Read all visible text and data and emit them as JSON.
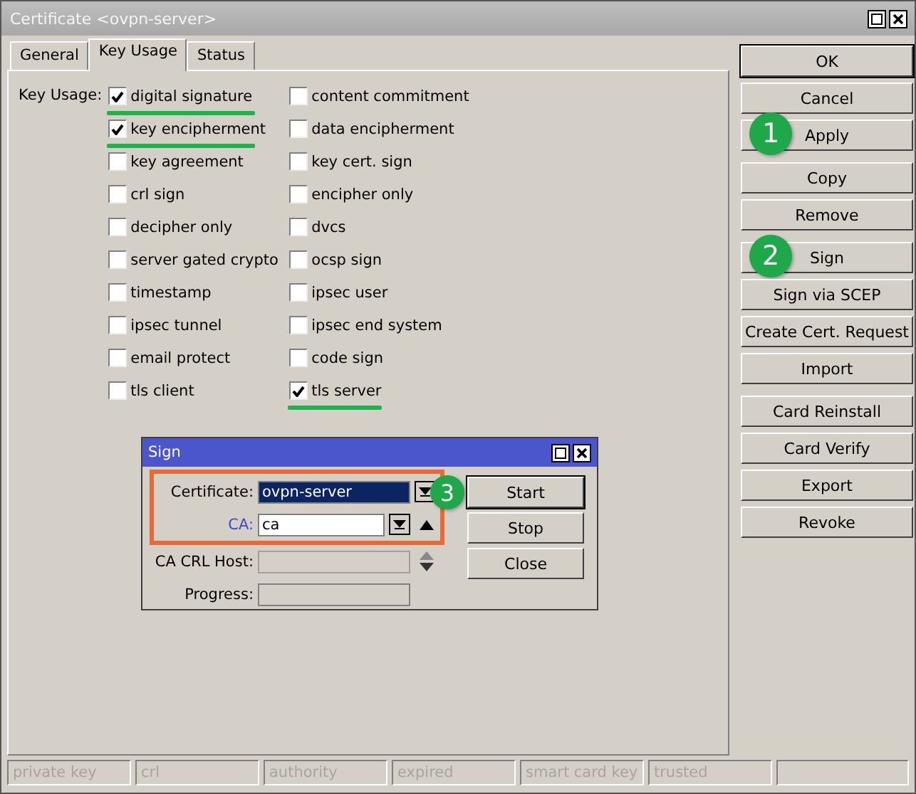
{
  "window": {
    "title": "Certificate <ovpn-server>"
  },
  "tabs": [
    {
      "label": "General",
      "selected": false
    },
    {
      "label": "Key Usage",
      "selected": true
    },
    {
      "label": "Status",
      "selected": false
    }
  ],
  "key_usage": {
    "label": "Key Usage:",
    "columns": [
      [
        {
          "label": "digital signature",
          "checked": true,
          "underlined": true
        },
        {
          "label": "key encipherment",
          "checked": true,
          "underlined": true
        },
        {
          "label": "key agreement",
          "checked": false,
          "underlined": false
        },
        {
          "label": "crl sign",
          "checked": false,
          "underlined": false
        },
        {
          "label": "decipher only",
          "checked": false,
          "underlined": false
        },
        {
          "label": "server gated crypto",
          "checked": false,
          "underlined": false
        },
        {
          "label": "timestamp",
          "checked": false,
          "underlined": false
        },
        {
          "label": "ipsec tunnel",
          "checked": false,
          "underlined": false
        },
        {
          "label": "email protect",
          "checked": false,
          "underlined": false
        },
        {
          "label": "tls client",
          "checked": false,
          "underlined": false
        }
      ],
      [
        {
          "label": "content commitment",
          "checked": false,
          "underlined": false
        },
        {
          "label": "data encipherment",
          "checked": false,
          "underlined": false
        },
        {
          "label": "key cert. sign",
          "checked": false,
          "underlined": false
        },
        {
          "label": "encipher only",
          "checked": false,
          "underlined": false
        },
        {
          "label": "dvcs",
          "checked": false,
          "underlined": false
        },
        {
          "label": "ocsp sign",
          "checked": false,
          "underlined": false
        },
        {
          "label": "ipsec user",
          "checked": false,
          "underlined": false
        },
        {
          "label": "ipsec end system",
          "checked": false,
          "underlined": false
        },
        {
          "label": "code sign",
          "checked": false,
          "underlined": false
        },
        {
          "label": "tls server",
          "checked": true,
          "underlined": true
        }
      ]
    ]
  },
  "button_groups": [
    [
      {
        "label": "OK",
        "default": true
      },
      {
        "label": "Cancel",
        "default": false
      },
      {
        "label": "Apply",
        "default": false,
        "step": "1"
      }
    ],
    [
      {
        "label": "Copy",
        "default": false
      },
      {
        "label": "Remove",
        "default": false
      }
    ],
    [
      {
        "label": "Sign",
        "default": false,
        "step": "2"
      },
      {
        "label": "Sign via SCEP",
        "default": false
      },
      {
        "label": "Create Cert. Request",
        "default": false
      },
      {
        "label": "Import",
        "default": false
      }
    ],
    [
      {
        "label": "Card Reinstall",
        "default": false
      },
      {
        "label": "Card Verify",
        "default": false
      },
      {
        "label": "Export",
        "default": false
      },
      {
        "label": "Revoke",
        "default": false
      }
    ]
  ],
  "sign_dialog": {
    "title": "Sign",
    "framed_fields": [
      {
        "label": "Certificate:",
        "kind": "combo",
        "value": "ovpn-server",
        "selected": true,
        "accent": false
      },
      {
        "label": "CA:",
        "kind": "combo-list",
        "value": "ca",
        "selected": false,
        "accent": true
      }
    ],
    "fields": [
      {
        "label": "CA CRL Host:",
        "kind": "list",
        "disabled": true,
        "accent": false
      },
      {
        "label": "Progress:",
        "kind": "plain",
        "accent": false
      }
    ],
    "buttons": [
      {
        "label": "Start",
        "default": true,
        "step": "3"
      },
      {
        "label": "Stop",
        "default": false
      },
      {
        "label": "Close",
        "default": false
      }
    ]
  },
  "status_bar": [
    {
      "label": "private key",
      "disabled": true
    },
    {
      "label": "crl",
      "disabled": true
    },
    {
      "label": "authority",
      "disabled": true
    },
    {
      "label": "expired",
      "disabled": true
    },
    {
      "label": "smart card key",
      "disabled": true
    },
    {
      "label": "trusted",
      "disabled": true
    }
  ]
}
